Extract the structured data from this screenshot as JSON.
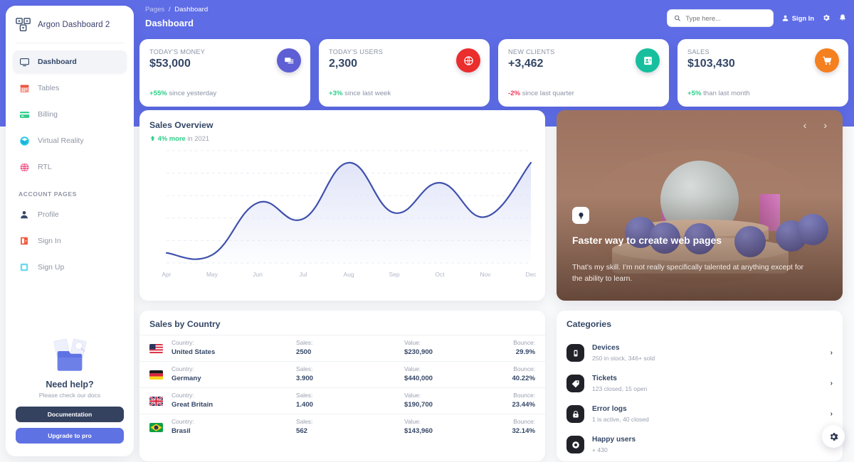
{
  "brand": {
    "name": "Argon Dashboard 2",
    "logo_icon": "argon-logo-icon"
  },
  "sidebar": {
    "items": [
      {
        "label": "Dashboard",
        "icon": "monitor-icon",
        "active": true
      },
      {
        "label": "Tables",
        "icon": "calendar-icon",
        "active": false
      },
      {
        "label": "Billing",
        "icon": "credit-card-icon",
        "active": false
      },
      {
        "label": "Virtual Reality",
        "icon": "vr-cube-icon",
        "active": false
      },
      {
        "label": "RTL",
        "icon": "globe-icon",
        "active": false
      }
    ],
    "section_label": "ACCOUNT PAGES",
    "account_items": [
      {
        "label": "Profile",
        "icon": "user-icon"
      },
      {
        "label": "Sign In",
        "icon": "signin-door-icon"
      },
      {
        "label": "Sign Up",
        "icon": "signup-box-icon"
      }
    ],
    "help": {
      "image_icon": "documents-folder-icon",
      "title": "Need help?",
      "subtitle": "Please check our docs",
      "doc_button": "Documentation",
      "upgrade_button": "Upgrade to pro"
    }
  },
  "topbar": {
    "breadcrumb_root": "Pages",
    "breadcrumb_sep": "/",
    "breadcrumb_current": "Dashboard",
    "page_title": "Dashboard",
    "search_placeholder": "Type here...",
    "search_value": "",
    "search_icon": "search-icon",
    "signin_label": "Sign In",
    "signin_icon": "user-icon",
    "settings_icon": "gear-icon",
    "bell_icon": "bell-icon"
  },
  "stats": [
    {
      "label": "TODAY'S MONEY",
      "value": "$53,000",
      "delta": "+55%",
      "delta_dir": "up",
      "note": "since yesterday",
      "icon": "money-stack-icon",
      "color": "#5e5fd4"
    },
    {
      "label": "TODAY'S USERS",
      "value": "2,300",
      "delta": "+3%",
      "delta_dir": "up",
      "note": "since last week",
      "icon": "world-globe-icon",
      "color": "#ea2d2d"
    },
    {
      "label": "NEW CLIENTS",
      "value": "+3,462",
      "delta": "-2%",
      "delta_dir": "down",
      "note": "since last quarter",
      "icon": "contact-card-icon",
      "color": "#17bf9e"
    },
    {
      "label": "SALES",
      "value": "$103,430",
      "delta": "+5%",
      "delta_dir": "up",
      "note": "than last month",
      "icon": "shopping-cart-icon",
      "color": "#f5801f"
    }
  ],
  "chart_data": {
    "type": "area",
    "title": "Sales Overview",
    "subtitle_delta": "4% more",
    "subtitle_rest": "in 2021",
    "subtitle_icon": "arrow-up-icon",
    "categories": [
      "Apr",
      "May",
      "Jun",
      "Jul",
      "Aug",
      "Sep",
      "Oct",
      "Nov",
      "Dec"
    ],
    "values": [
      50,
      40,
      300,
      220,
      500,
      250,
      400,
      230,
      500
    ],
    "xlabel": "",
    "ylabel": "",
    "ylim": [
      0,
      560
    ],
    "grid": true,
    "legend": "none",
    "line_color": "#3f50ad",
    "fill_color": "#dfe3f7"
  },
  "promo": {
    "badge_icon": "lightbulb-icon",
    "title": "Faster way to create web pages",
    "body": "That’s my skill. I’m not really specifically talented at anything except for the ability to learn.",
    "prev_icon": "chevron-left-icon",
    "next_icon": "chevron-right-icon"
  },
  "country": {
    "title": "Sales by Country",
    "headers": {
      "country": "Country:",
      "sales": "Sales:",
      "value": "Value:",
      "bounce": "Bounce:"
    },
    "rows": [
      {
        "flag": "flag-us-icon",
        "country": "United States",
        "sales": "2500",
        "value": "$230,900",
        "bounce": "29.9%"
      },
      {
        "flag": "flag-de-icon",
        "country": "Germany",
        "sales": "3.900",
        "value": "$440,000",
        "bounce": "40.22%"
      },
      {
        "flag": "flag-gb-icon",
        "country": "Great Britain",
        "sales": "1.400",
        "value": "$190,700",
        "bounce": "23.44%"
      },
      {
        "flag": "flag-br-icon",
        "country": "Brasil",
        "sales": "562",
        "value": "$143,960",
        "bounce": "32.14%"
      }
    ]
  },
  "categories": {
    "title": "Categories",
    "items": [
      {
        "icon": "device-phone-icon",
        "name": "Devices",
        "desc": "250 in stock, 346+ sold",
        "arrow": "›"
      },
      {
        "icon": "tag-ticket-icon",
        "name": "Tickets",
        "desc": "123 closed, 15 open",
        "arrow": "›"
      },
      {
        "icon": "lock-icon",
        "name": "Error logs",
        "desc": "1 is active, 40 closed",
        "arrow": "›"
      },
      {
        "icon": "smile-face-icon",
        "name": "Happy users",
        "desc": "+ 430",
        "arrow": "›"
      }
    ]
  },
  "fab": {
    "icon": "gear-icon"
  }
}
